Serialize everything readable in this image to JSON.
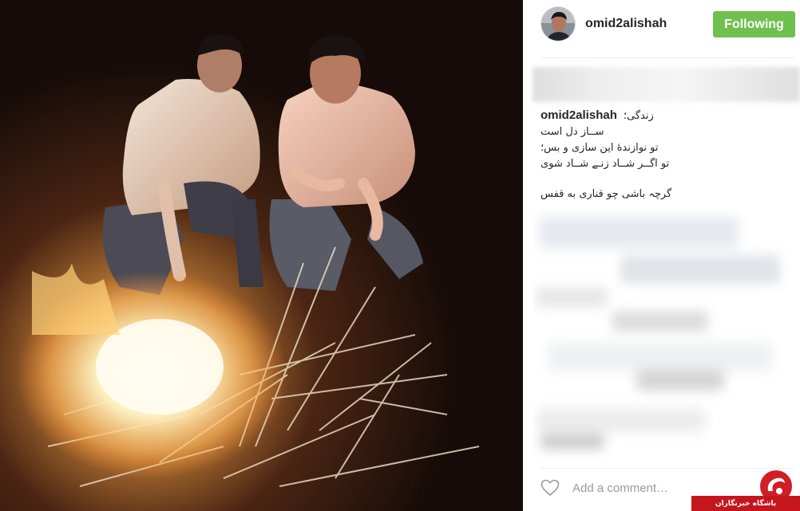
{
  "post": {
    "username": "omid2alishah",
    "follow_label": "Following",
    "caption": {
      "username": "omid2alishah",
      "first_line": "زندگی؛",
      "lines": [
        "ســاز دل است",
        "تو نوازندۀ این سازی و بس؛",
        "تو اگــر شــاد زنـے شــاد شوی",
        "گرچہ باشی چو قناری به قفس"
      ]
    },
    "comment_placeholder": "Add a comment…"
  },
  "icons": {
    "like": "heart-icon",
    "avatar": "avatar",
    "watermark": "news-agency-logo"
  },
  "watermark": {
    "text": "باشگاه خبرنگاران"
  },
  "colors": {
    "follow_button": "#70c050",
    "watermark_red": "#c4161c",
    "text": "#262626",
    "placeholder": "#9a9a9a"
  }
}
